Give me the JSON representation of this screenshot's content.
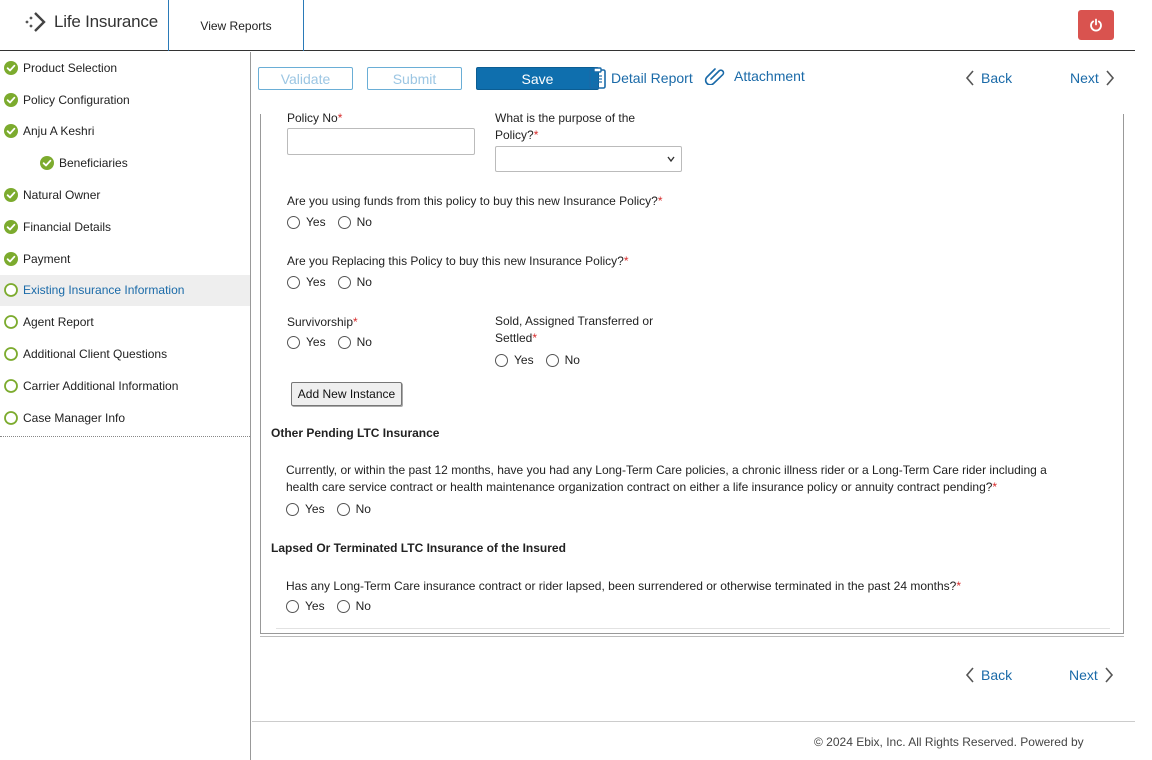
{
  "header": {
    "app_title": "Life Insurance",
    "view_reports_label": "View Reports",
    "logo_icon": "chevron-dots-logo",
    "power_icon": "power-icon",
    "power_color": "#d9534f"
  },
  "sidebar": {
    "items": [
      {
        "label": "Product Selection",
        "status": "complete"
      },
      {
        "label": "Policy Configuration",
        "status": "complete"
      },
      {
        "label": "Anju A Keshri",
        "status": "complete"
      },
      {
        "label": "Beneficiaries",
        "status": "complete"
      },
      {
        "label": "Natural Owner",
        "status": "complete"
      },
      {
        "label": "Financial Details",
        "status": "complete"
      },
      {
        "label": "Payment",
        "status": "complete"
      },
      {
        "label": "Existing Insurance Information",
        "status": "current"
      },
      {
        "label": "Agent Report",
        "status": "pending"
      },
      {
        "label": "Additional Client Questions",
        "status": "pending"
      },
      {
        "label": "Carrier Additional Information",
        "status": "pending"
      },
      {
        "label": "Case Manager Info",
        "status": "pending"
      }
    ],
    "complete_color": "#7cab2e",
    "active_color": "#1a6aa8"
  },
  "toolbar": {
    "validate_label": "Validate",
    "submit_label": "Submit",
    "save_label": "Save",
    "detail_report_label": "Detail Report",
    "attachment_label": "Attachment",
    "back_label": "Back",
    "next_label": "Next",
    "accent_color": "#0f6fae"
  },
  "form": {
    "policy_no_label": "Policy No",
    "purpose_label_line1": "What is the purpose of the",
    "purpose_label_line2": "Policy?",
    "funds_question": "Are you using funds from this policy to buy this new Insurance Policy?",
    "replacing_question": "Are you Replacing this Policy to buy this new Insurance Policy?",
    "survivorship_label": "Survivorship",
    "sold_label_line1": "Sold, Assigned Transferred or",
    "sold_label_line2": "Settled",
    "yes_label": "Yes",
    "no_label": "No",
    "add_new_instance_label": "Add New Instance",
    "required_mark": "*"
  },
  "other_pending": {
    "title": "Other Pending LTC Insurance",
    "question_line1": "Currently, or within the past 12 months, have you had any Long-Term Care policies, a chronic illness rider or a Long-Term Care rider including a",
    "question_line2": "health care service contract or health maintenance organization contract on either a life insurance policy or annuity contract pending?"
  },
  "lapsed": {
    "title": "Lapsed Or Terminated LTC Insurance of the Insured",
    "question": "Has any Long-Term Care insurance contract or rider lapsed, been surrendered or otherwise terminated in the past 24 months?"
  },
  "footer": {
    "copyright": "© 2024 Ebix, Inc. All Rights Reserved. Powered by"
  }
}
